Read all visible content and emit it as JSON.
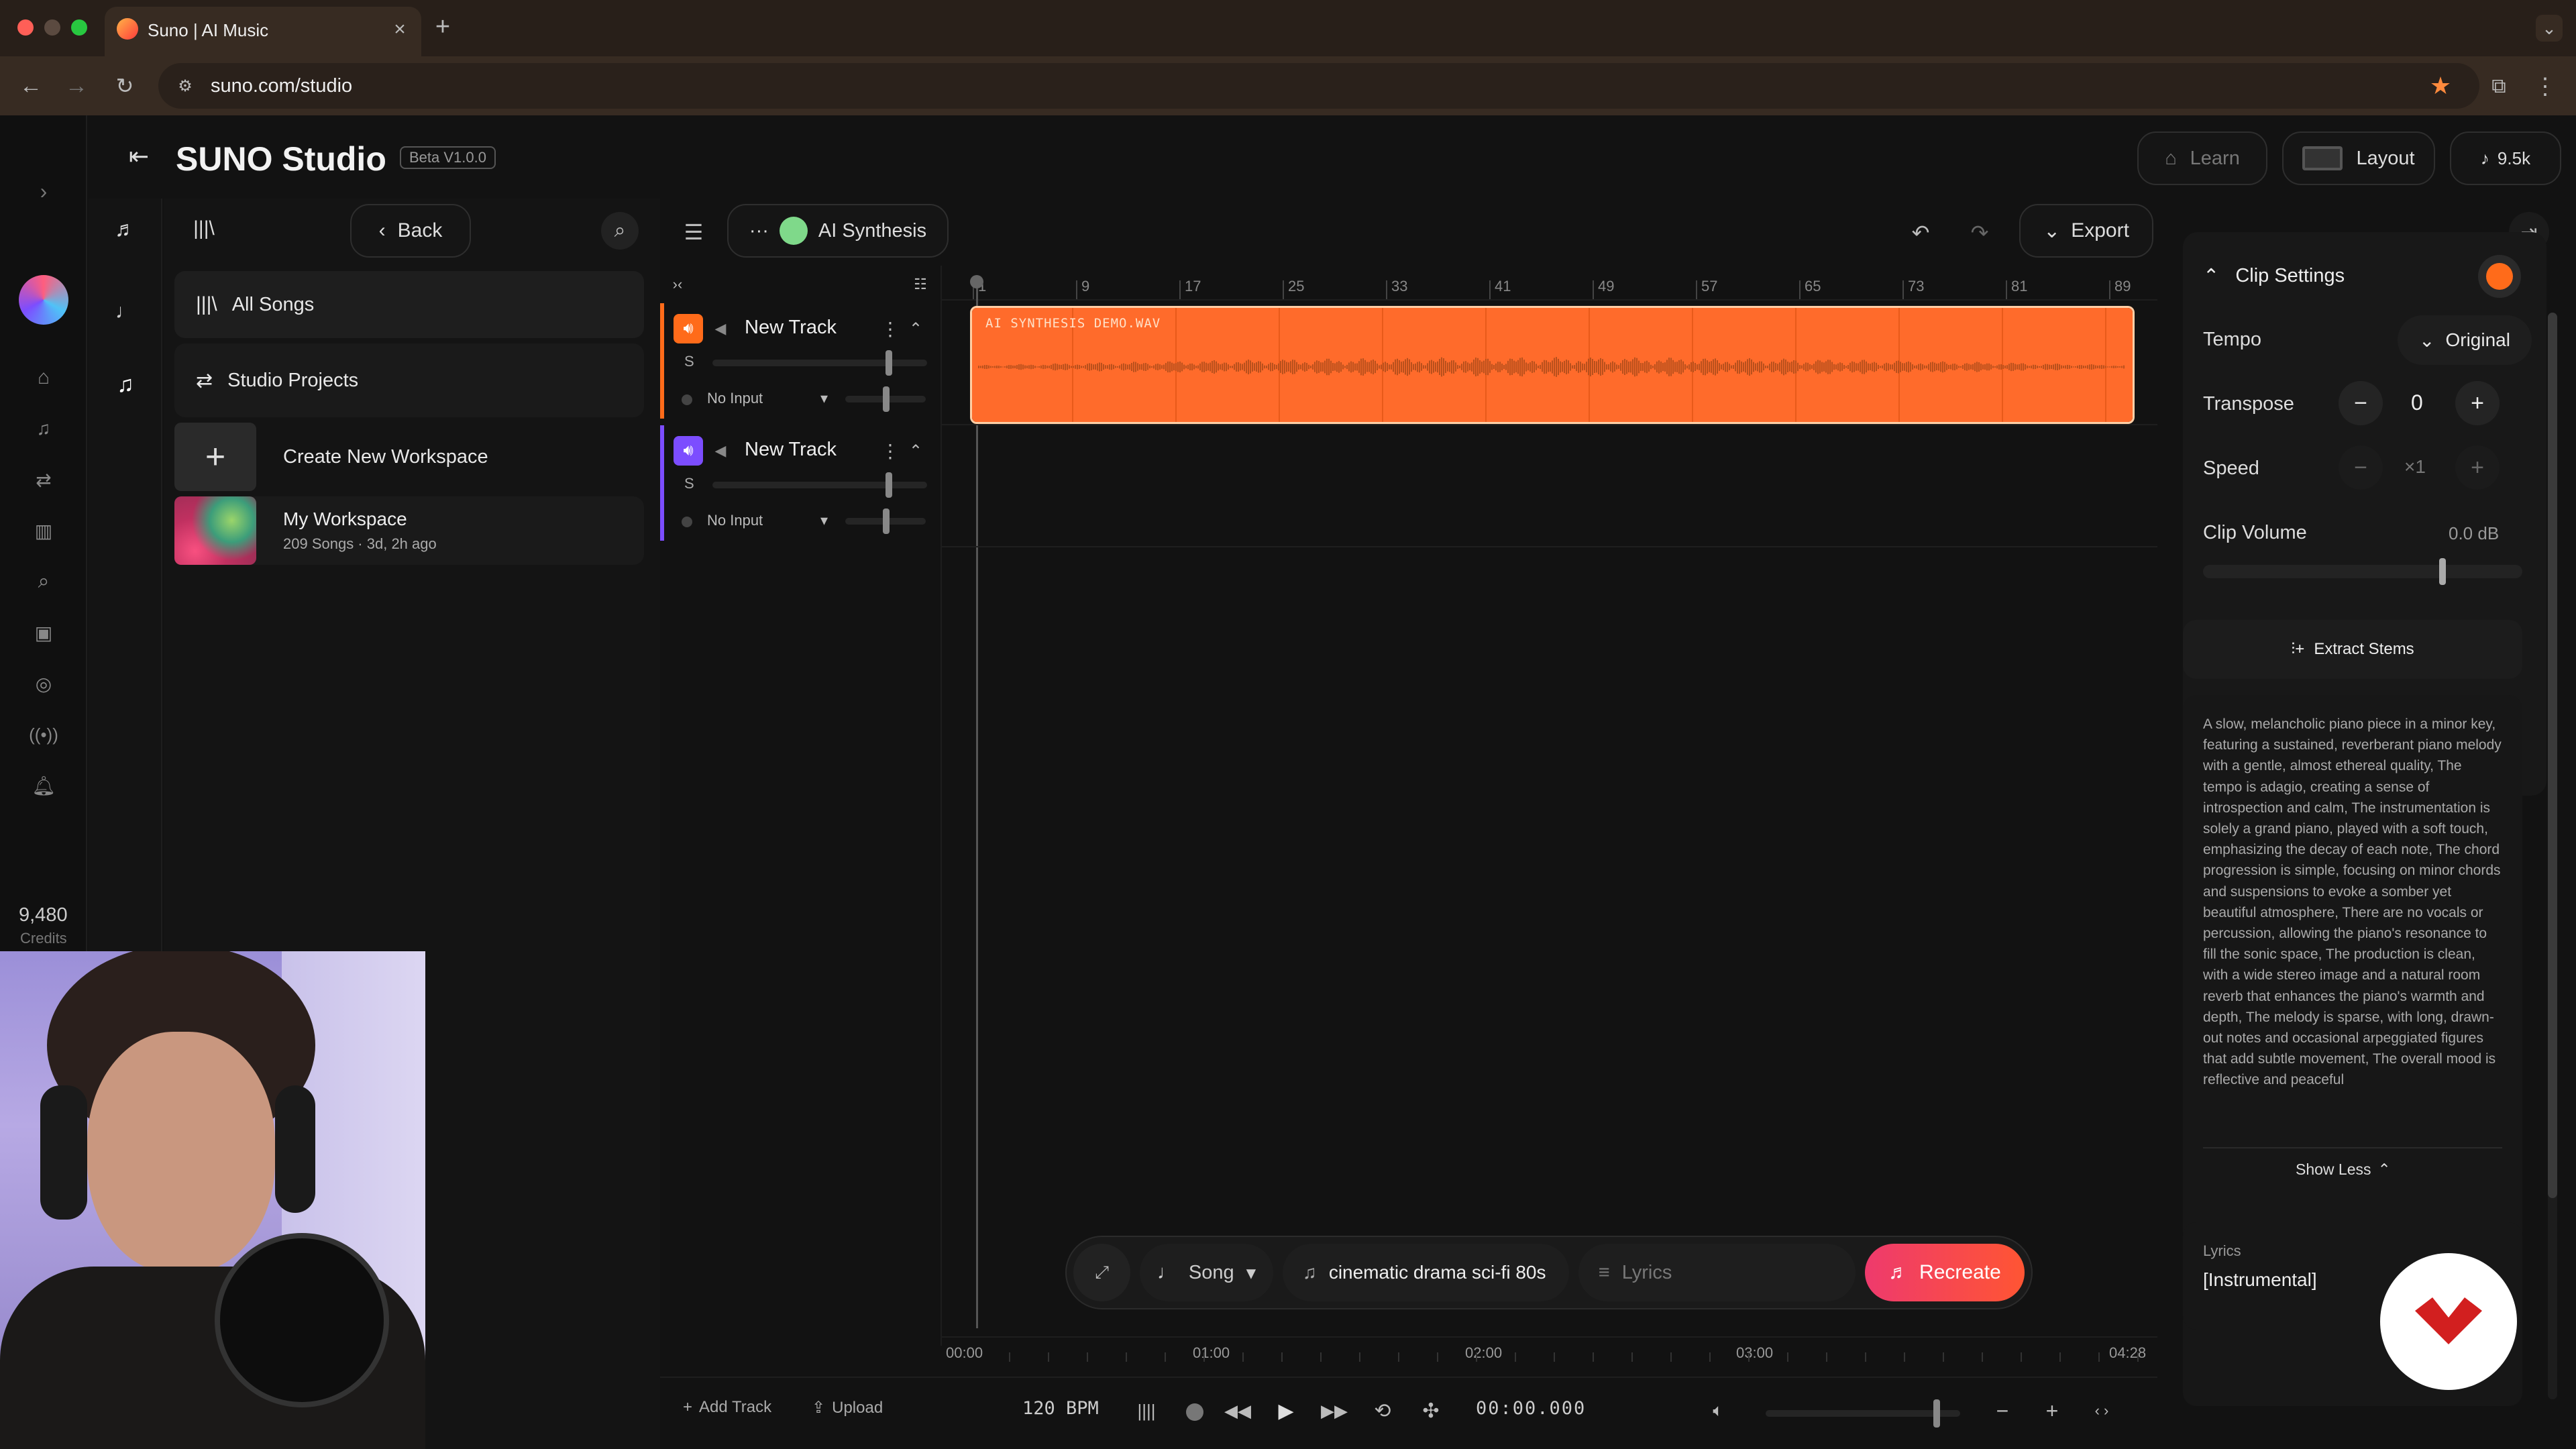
{
  "browser": {
    "tab_title": "Suno | AI Music",
    "url": "suno.com/studio"
  },
  "leftbar": {
    "credits_value": "9,480",
    "credits_label": "Credits"
  },
  "header": {
    "title": "SUNO Studio",
    "beta_badge": "Beta V1.0.0",
    "learn": "Learn",
    "layout": "Layout",
    "count": "9.5k"
  },
  "library": {
    "back": "Back",
    "items": [
      {
        "label": "All Songs"
      },
      {
        "label": "Studio Projects"
      },
      {
        "label": "Create New Workspace"
      }
    ],
    "workspace": {
      "name": "My Workspace",
      "meta": "209 Songs · 3d, 2h ago"
    }
  },
  "toolbar": {
    "project_name": "AI Synthesis",
    "export": "Export"
  },
  "tracks": [
    {
      "name": "New Track",
      "solo": "S",
      "input": "No Input",
      "color": "#ff6b1a"
    },
    {
      "name": "New Track",
      "solo": "S",
      "input": "No Input",
      "color": "#7c4dff"
    }
  ],
  "ruler": {
    "bars": [
      "1",
      "9",
      "17",
      "25",
      "33",
      "41",
      "49",
      "57",
      "65",
      "73",
      "81",
      "89"
    ]
  },
  "clip": {
    "name": "AI SYNTHESIS DEMO.WAV",
    "color": "#ff6b2b"
  },
  "timeline": {
    "labels": [
      "00:00",
      "01:00",
      "02:00",
      "03:00",
      "04:28"
    ]
  },
  "generate": {
    "mode": "Song",
    "style": "cinematic drama sci-fi 80s",
    "lyrics_placeholder": "Lyrics",
    "recreate": "Recreate"
  },
  "transport": {
    "add_track": "Add Track",
    "upload": "Upload",
    "bpm": "120 BPM",
    "time": "00:00.000"
  },
  "clip_settings": {
    "title": "Clip Settings",
    "tempo_label": "Tempo",
    "tempo_value": "Original",
    "transpose_label": "Transpose",
    "transpose_value": "0",
    "speed_label": "Speed",
    "speed_value": "×1",
    "volume_label": "Clip Volume",
    "volume_value": "0.0 dB",
    "extract_stems": "Extract Stems",
    "description": "A slow, melancholic piano piece in a minor key, featuring a sustained, reverberant piano melody with a gentle, almost ethereal quality, The tempo is adagio, creating a sense of introspection and calm, The instrumentation is solely a grand piano, played with a soft touch, emphasizing the decay of each note, The chord progression is simple, focusing on minor chords and suspensions to evoke a somber yet beautiful atmosphere, There are no vocals or percussion, allowing the piano's resonance to fill the sonic space, The production is clean, with a wide stereo image and a natural room reverb that enhances the piano's warmth and depth, The melody is sparse, with long, drawn-out notes and occasional arpeggiated figures that add subtle movement, The overall mood is reflective and peaceful",
    "show_less": "Show Less",
    "lyrics_label": "Lyrics",
    "lyrics_value": "[Instrumental]"
  }
}
